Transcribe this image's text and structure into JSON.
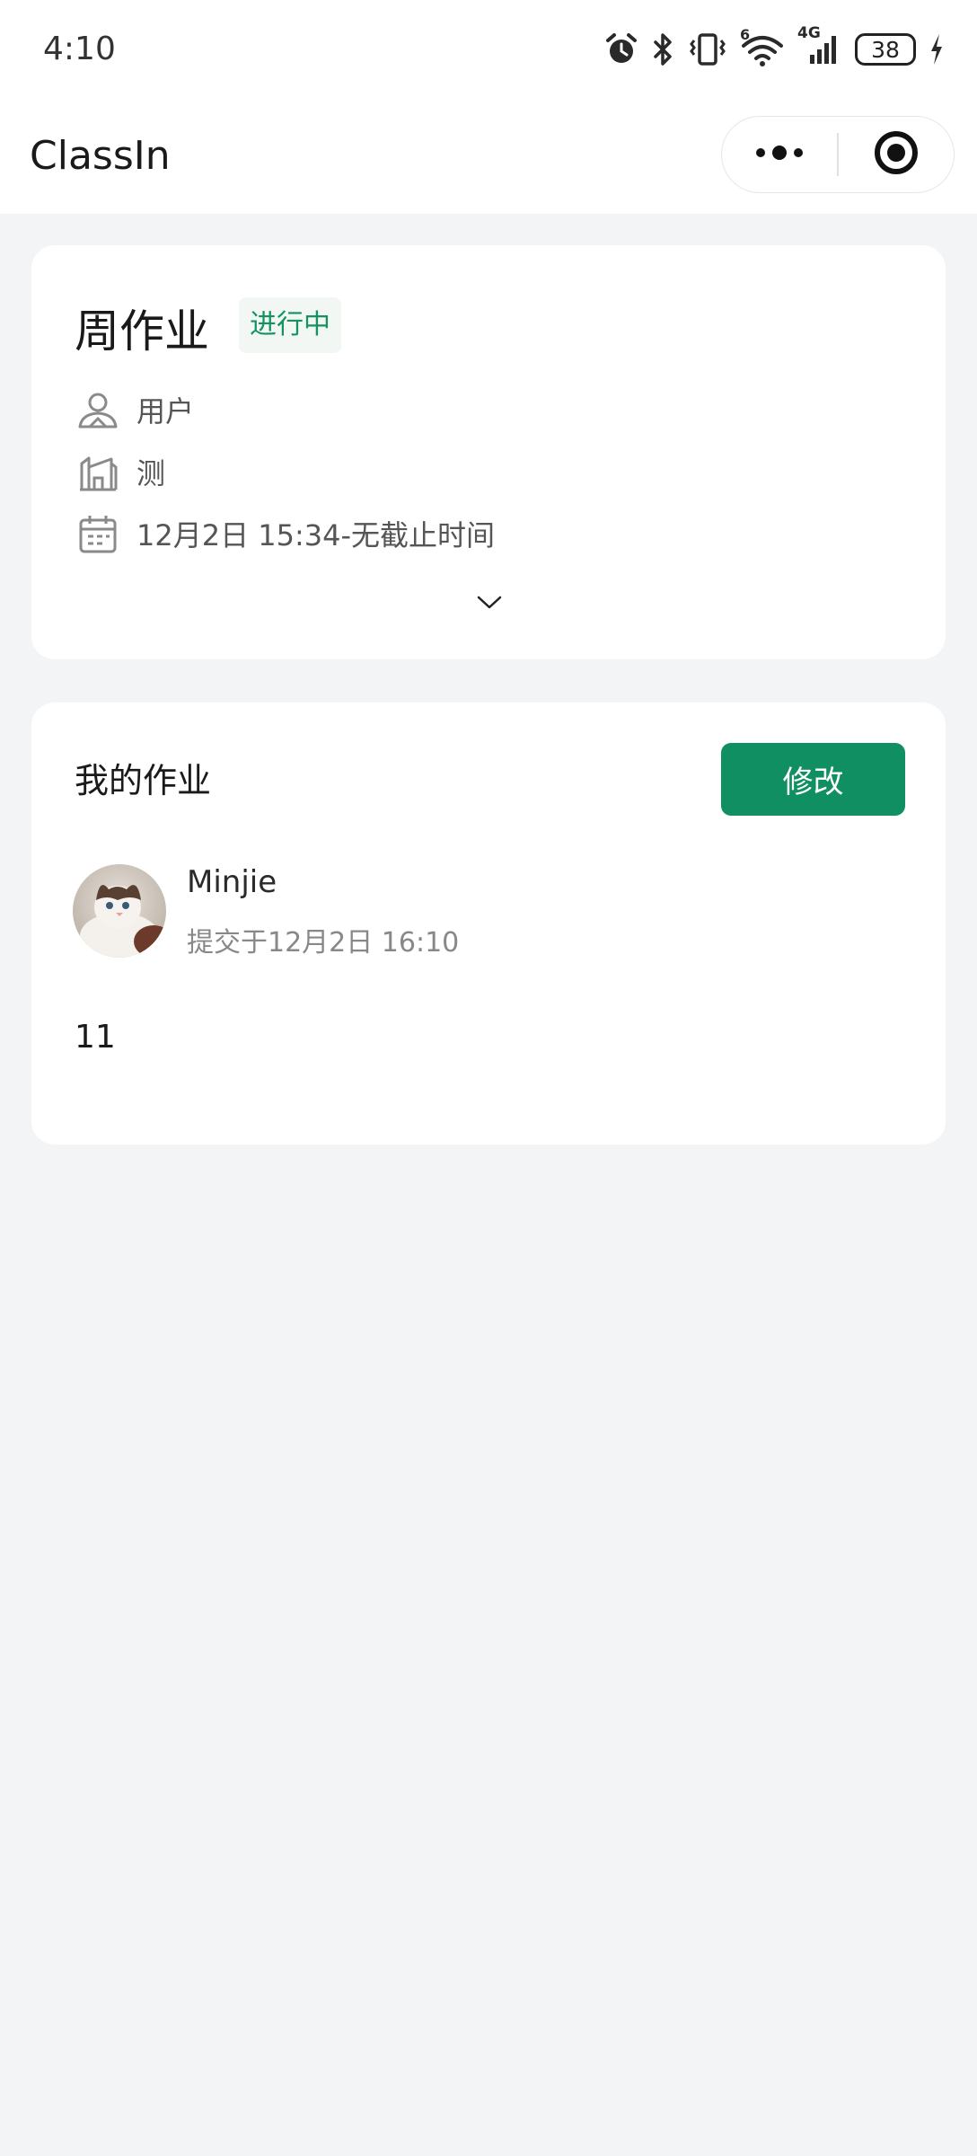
{
  "status_bar": {
    "time": "4:10",
    "network": "4G",
    "wifi_badge": "6",
    "battery": "38"
  },
  "nav": {
    "title": "ClassIn"
  },
  "assignment": {
    "title": "周作业",
    "status": "进行中",
    "status_color": "#14925f",
    "author": "用户",
    "class_name": "测",
    "time_range": "12月2日  15:34-无截止时间"
  },
  "my_work": {
    "title": "我的作业",
    "edit_label": "修改",
    "accent": "#0f8f62",
    "submitter": "Minjie",
    "submitted_at": "提交于12月2日  16:10",
    "content": "11"
  },
  "icons": [
    "alarm-icon",
    "bluetooth-icon",
    "vibrate-icon",
    "wifi-icon",
    "signal-icon",
    "battery-icon",
    "charging-icon",
    "more-icon",
    "close-mini-program-icon",
    "user-icon",
    "building-icon",
    "calendar-icon",
    "chevron-down-icon"
  ]
}
